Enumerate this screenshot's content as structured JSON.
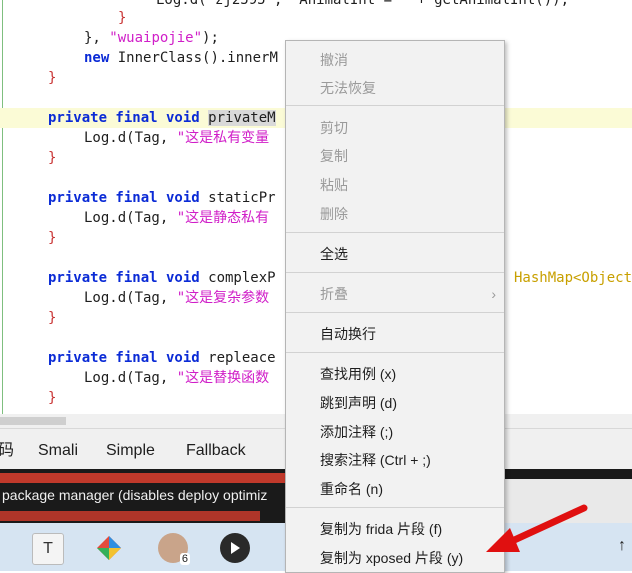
{
  "editor": {
    "lines": {
      "l0": "Log.d(\"zj2595\", \"AnimalInt = \" + getAnimalInt());",
      "l1_brace": "}",
      "l2a": "}, ",
      "l2_str": "\"wuaipojie\"",
      "l2b": ");",
      "l3_kw": "new",
      "l3b": " InnerClass().innerM",
      "l4_brace": "}",
      "p1_kw": "private final void",
      "p1_sel": "privateM",
      "p1_log": "Log.d(Tag, ",
      "p1_str": "\"这是私有变量",
      "p1_brace": "}",
      "p2_kw": "private final void",
      "p2_name": " staticPr",
      "p2_log": "Log.d(Tag, ",
      "p2_str": "\"这是静态私有",
      "p2_brace": "}",
      "p3_kw": "private final void",
      "p3_name": " complexP",
      "p3_tail": "HashMap<Object",
      "p3_log": "Log.d(Tag, ",
      "p3_str": "\"这是复杂参数",
      "p3_brace": "}",
      "p4_kw": "private final void",
      "p4_name": " repleace",
      "p4_log": "Log.d(Tag, ",
      "p4_str": "\"这是替换函数",
      "p4_brace": "}"
    }
  },
  "tabs": [
    "码",
    "Smali",
    "Simple",
    "Fallback"
  ],
  "console": {
    "message": "package manager (disables deploy optimiz"
  },
  "taskbar": {
    "icons": [
      "text-editor-icon",
      "gemini-icon",
      "avatar-app-icon",
      "media-player-icon"
    ],
    "text_icon_label": "T",
    "badge": "6",
    "arrow": "↑"
  },
  "context_menu": {
    "items": [
      {
        "label": "撤消",
        "enabled": false
      },
      {
        "label": "无法恢复",
        "enabled": false
      },
      {
        "label": "剪切",
        "enabled": false
      },
      {
        "label": "复制",
        "enabled": false
      },
      {
        "label": "粘贴",
        "enabled": false
      },
      {
        "label": "删除",
        "enabled": false
      },
      {
        "label": "全选",
        "enabled": true
      },
      {
        "label": "折叠",
        "enabled": false
      },
      {
        "label": "自动换行",
        "enabled": true
      },
      {
        "label": "查找用例 (x)",
        "enabled": true
      },
      {
        "label": "跳到声明 (d)",
        "enabled": true
      },
      {
        "label": "添加注释 (;)",
        "enabled": true
      },
      {
        "label": "搜索注释 (Ctrl + ;)",
        "enabled": true
      },
      {
        "label": "重命名 (n)",
        "enabled": true
      },
      {
        "label": "复制为 frida 片段 (f)",
        "enabled": true
      },
      {
        "label": "复制为 xposed 片段 (y)",
        "enabled": true
      }
    ],
    "submenu_chevron": "›"
  },
  "colors": {
    "annotation_arrow": "#e01010",
    "keyword": "#0b2bd6",
    "string": "#d01ec8"
  }
}
